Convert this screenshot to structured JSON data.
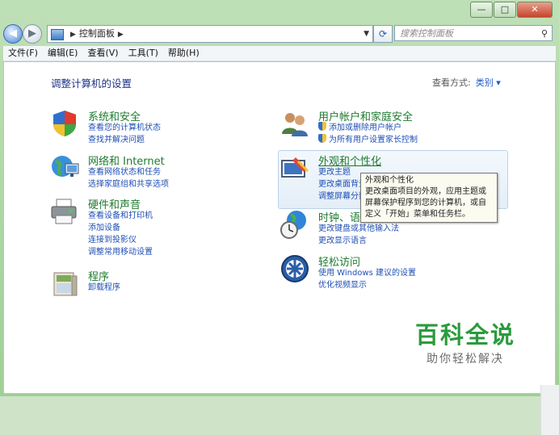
{
  "window": {
    "title_buttons": {
      "minimize": "—",
      "maximize": "□",
      "close": "✕"
    }
  },
  "addressbar": {
    "path": "控制面板",
    "search_placeholder": "搜索控制面板"
  },
  "menu": [
    "文件(F)",
    "编辑(E)",
    "查看(V)",
    "工具(T)",
    "帮助(H)"
  ],
  "main": {
    "heading": "调整计算机的设置",
    "view_by_label": "查看方式:",
    "view_by_value": "类别 ▾"
  },
  "categories": [
    {
      "title": "系统和安全",
      "links": [
        "查看您的计算机状态",
        "查找并解决问题"
      ]
    },
    {
      "title": "网络和 Internet",
      "links": [
        "查看网络状态和任务",
        "选择家庭组和共享选项"
      ]
    },
    {
      "title": "硬件和声音",
      "links": [
        "查看设备和打印机",
        "添加设备",
        "连接到投影仪",
        "调整常用移动设置"
      ]
    },
    {
      "title": "程序",
      "links": [
        "卸载程序"
      ]
    },
    {
      "title": "用户帐户和家庭安全",
      "links": [
        "添加或删除用户帐户",
        "为所有用户设置家长控制"
      ]
    },
    {
      "title": "外观和个性化",
      "links": [
        "更改主题",
        "更改桌面背景",
        "调整屏幕分辨"
      ]
    },
    {
      "title": "时钟、语",
      "links": [
        "更改键盘或其他输入法",
        "更改显示语言"
      ]
    },
    {
      "title": "轻松访问",
      "links": [
        "使用 Windows 建议的设置",
        "优化视频显示"
      ]
    }
  ],
  "tooltip": {
    "title": "外观和个性化",
    "text": "更改桌面项目的外观，应用主题或屏幕保护程序到您的计算机，或自定义「开始」菜单和任务栏。"
  },
  "watermark": {
    "main": "百科全说",
    "sub": "助你轻松解决"
  },
  "colors": {
    "category_title": "#1e7a2f",
    "link": "#1f4fb4",
    "heading": "#1e3287",
    "watermark": "#2b9a3d"
  }
}
